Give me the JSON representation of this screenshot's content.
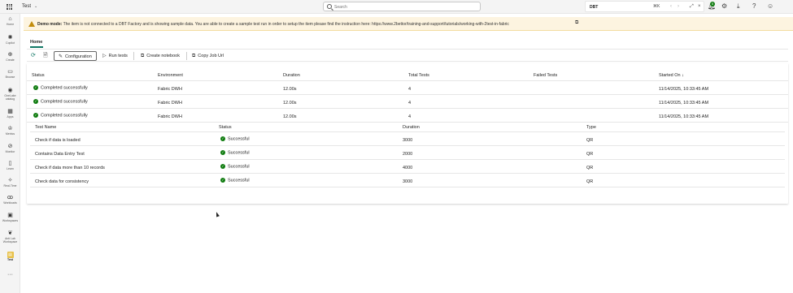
{
  "topbar": {
    "workspace_title": "Test",
    "search_placeholder": "Search",
    "dbt_label": "DBT",
    "shortcut": "⌘K",
    "notification_count": "5"
  },
  "rail": {
    "items": [
      {
        "label": "Home",
        "icon": "home-icon",
        "glyph": "⌂"
      },
      {
        "label": "Copilot",
        "icon": "copilot-icon",
        "glyph": "✺"
      },
      {
        "label": "Create",
        "icon": "create-icon",
        "glyph": "⊕"
      },
      {
        "label": "Browse",
        "icon": "browse-icon",
        "glyph": "▭"
      },
      {
        "label": "OneLake catalog",
        "icon": "onelake-icon",
        "glyph": "◉"
      },
      {
        "label": "Apps",
        "icon": "apps-icon",
        "glyph": "▦"
      },
      {
        "label": "Metrics",
        "icon": "metrics-icon",
        "glyph": "♔"
      },
      {
        "label": "Monitor",
        "icon": "monitor-icon",
        "glyph": "⊘"
      },
      {
        "label": "Learn",
        "icon": "learn-icon",
        "glyph": "▯"
      },
      {
        "label": "Real-Time",
        "icon": "realtime-icon",
        "glyph": "✧"
      },
      {
        "label": "Workloads",
        "icon": "workloads-icon",
        "glyph": "ꝏ"
      },
      {
        "label": "Workspaces",
        "icon": "workspaces-icon",
        "glyph": "▣"
      },
      {
        "label": "Anti Lab Workspace",
        "icon": "workspace-icon",
        "glyph": "❦"
      },
      {
        "label": "Test",
        "icon": "test-item-icon",
        "glyph": "▤"
      },
      {
        "label": "",
        "icon": "more-icon",
        "glyph": "···"
      }
    ]
  },
  "banner": {
    "mode": "Demo mode:",
    "text": "The item is not connected to a DBT Factory and is showing sample data. You are able to create a sample test run in order to setup the item please find the instruction here: https://www.2bettor/training-and-support/tutorials/working-with-2test-in-fabric",
    "icon": "warning-icon"
  },
  "tabs": {
    "home": "Home"
  },
  "toolbar": {
    "configuration": "Configuration",
    "run_tests": "Run tests",
    "create_notebook": "Create notebook",
    "copy_job_url": "Copy Job Url"
  },
  "runs": {
    "headers": [
      "Status",
      "Environment",
      "Duration",
      "Total Tests",
      "Failed Tests",
      "Started On ↓"
    ],
    "rows": [
      {
        "status": "Completed successfully",
        "environment": "Fabric DWH",
        "duration": "12.00s",
        "total": "4",
        "failed": "",
        "started": "11/14/2025, 10:33:45 AM"
      },
      {
        "status": "Completed successfully",
        "environment": "Fabric DWH",
        "duration": "12.00s",
        "total": "4",
        "failed": "",
        "started": "11/14/2025, 10:33:45 AM"
      },
      {
        "status": "Completed successfully",
        "environment": "Fabric DWH",
        "duration": "12.00s",
        "total": "4",
        "failed": "",
        "started": "11/14/2025, 10:33:45 AM"
      }
    ]
  },
  "tests": {
    "headers": [
      "Test Name",
      "Status",
      "Duration",
      "Type"
    ],
    "rows": [
      {
        "name": "Check if data is loaded",
        "status": "Successful",
        "duration": "3000",
        "type": "QR"
      },
      {
        "name": "Contains Data Entry Test",
        "status": "Successful",
        "duration": "2000",
        "type": "QR"
      },
      {
        "name": "Check if data more than 10 records",
        "status": "Successful",
        "duration": "4000",
        "type": "QR"
      },
      {
        "name": "Check data for consistency",
        "status": "Successful",
        "duration": "3000",
        "type": "QR"
      }
    ]
  },
  "colors": {
    "accent": "#117865",
    "success": "#107c10",
    "banner": "#fdf4e0",
    "warning": "#c28d0d"
  }
}
